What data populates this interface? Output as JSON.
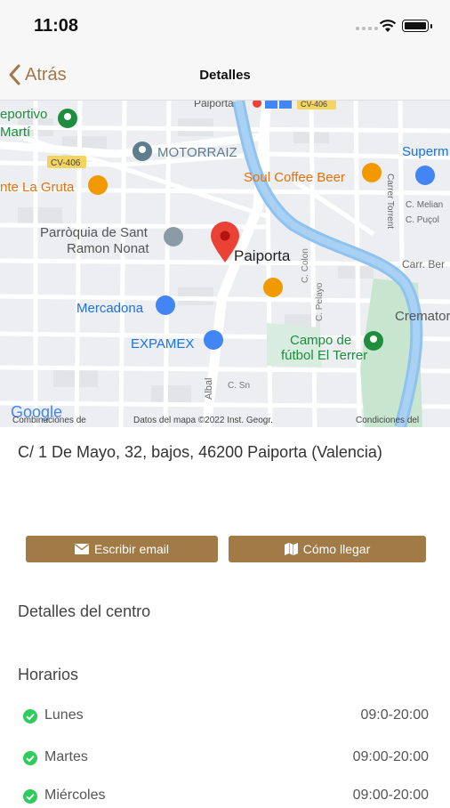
{
  "status_bar": {
    "time": "11:08"
  },
  "nav": {
    "back_label": "Atrás",
    "title": "Detalles"
  },
  "map": {
    "labels": {
      "deportivo": "eportivo",
      "marti": "Martí",
      "cv406_a": "CV-406",
      "cv406_b": "CV-406",
      "motorraiz": "MOTORRAIZ",
      "gruta": "nte La Gruta",
      "soul": "Soul Coffee Beer",
      "supermercado": "Superm",
      "carrer_torrent": "Carrer Torrent",
      "c_melian": "C. Melian",
      "c_pucol": "C. Puçol",
      "parroquia_1": "Parròquia de Sant",
      "parroquia_2": "Ramon Nonat",
      "paiporta": "Paiporta",
      "paiporta_top": "Paiporta",
      "carr_ber": "Carr. Ber",
      "mercadona": "Mercadona",
      "c_colon": "C. Colon",
      "c_pelayo": "C. Pelayo",
      "crematorio": "Crematorio",
      "expamex": "EXPAMEX",
      "campo_1": "Campo de",
      "campo_2": "fútbol El Terrer",
      "albal": "Albal",
      "c_sn": "C. Sn",
      "google": "Google",
      "combinaciones": "Combinaciones de",
      "datos": "Datos del mapa ©2022 Inst. Geogr.",
      "condiciones": "Condiciones del"
    }
  },
  "address": "C/ 1 De Mayo, 32, bajos, 46200 Paiporta (Valencia)",
  "buttons": {
    "email": "Escribir email",
    "directions": "Cómo llegar"
  },
  "center_details_title": "Detalles del centro",
  "schedule": {
    "title": "Horarios",
    "rows": [
      {
        "day": "Lunes",
        "hours": "09:0-20:00"
      },
      {
        "day": "Martes",
        "hours": "09:00-20:00"
      },
      {
        "day": "Miércoles",
        "hours": "09:00-20:00"
      }
    ]
  },
  "colors": {
    "accent": "#a27a45",
    "back": "#a0784c",
    "check": "#2ecc5c",
    "river": "#8fc2ef"
  },
  "icons": [
    "chevron-left-icon",
    "wifi-icon",
    "battery-icon",
    "map-pin-icon",
    "mail-icon",
    "map-icon",
    "check-circle-icon"
  ]
}
